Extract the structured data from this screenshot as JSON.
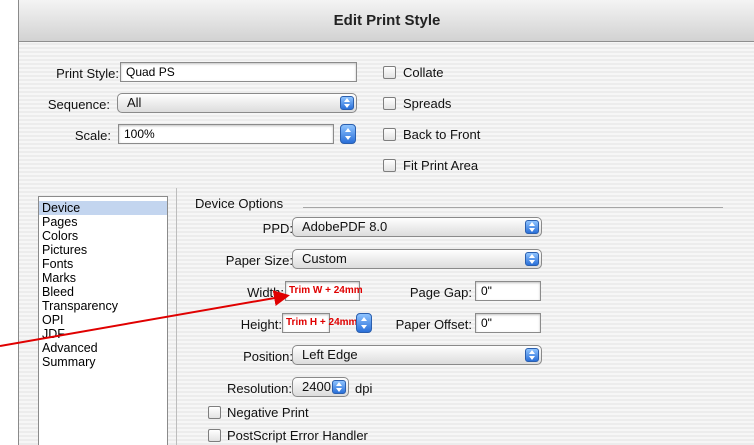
{
  "window": {
    "title": "Edit Print Style"
  },
  "top": {
    "print_style_label": "Print Style:",
    "print_style_value": "Quad PS",
    "sequence_label": "Sequence:",
    "sequence_value": "All",
    "scale_label": "Scale:",
    "scale_value": "100%",
    "collate_label": "Collate",
    "spreads_label": "Spreads",
    "back_to_front_label": "Back to Front",
    "fit_print_area_label": "Fit Print Area"
  },
  "sidebar": {
    "items": [
      {
        "label": "Device",
        "selected": true
      },
      {
        "label": "Pages"
      },
      {
        "label": "Colors"
      },
      {
        "label": "Pictures"
      },
      {
        "label": "Fonts"
      },
      {
        "label": "Marks"
      },
      {
        "label": "Bleed"
      },
      {
        "label": "Transparency"
      },
      {
        "label": "OPI"
      },
      {
        "label": "JDF"
      },
      {
        "label": "Advanced"
      },
      {
        "label": "Summary"
      }
    ]
  },
  "device": {
    "group_title": "Device Options",
    "ppd_label": "PPD:",
    "ppd_value": "AdobePDF 8.0",
    "paper_size_label": "Paper Size:",
    "paper_size_value": "Custom",
    "width_label": "Width:",
    "width_value": "Trim W + 24mm",
    "page_gap_label": "Page Gap:",
    "page_gap_value": "0\"",
    "height_label": "Height:",
    "height_value": "Trim H + 24mm",
    "paper_offset_label": "Paper Offset:",
    "paper_offset_value": "0\"",
    "position_label": "Position:",
    "position_value": "Left Edge",
    "resolution_label": "Resolution:",
    "resolution_value": "2400",
    "resolution_unit": "dpi",
    "negative_print_label": "Negative Print",
    "postscript_error_label": "PostScript Error Handler"
  },
  "colors": {
    "annotation": "#e00000",
    "selection": "#c3d5ef",
    "accent": "#2a6fd8"
  }
}
